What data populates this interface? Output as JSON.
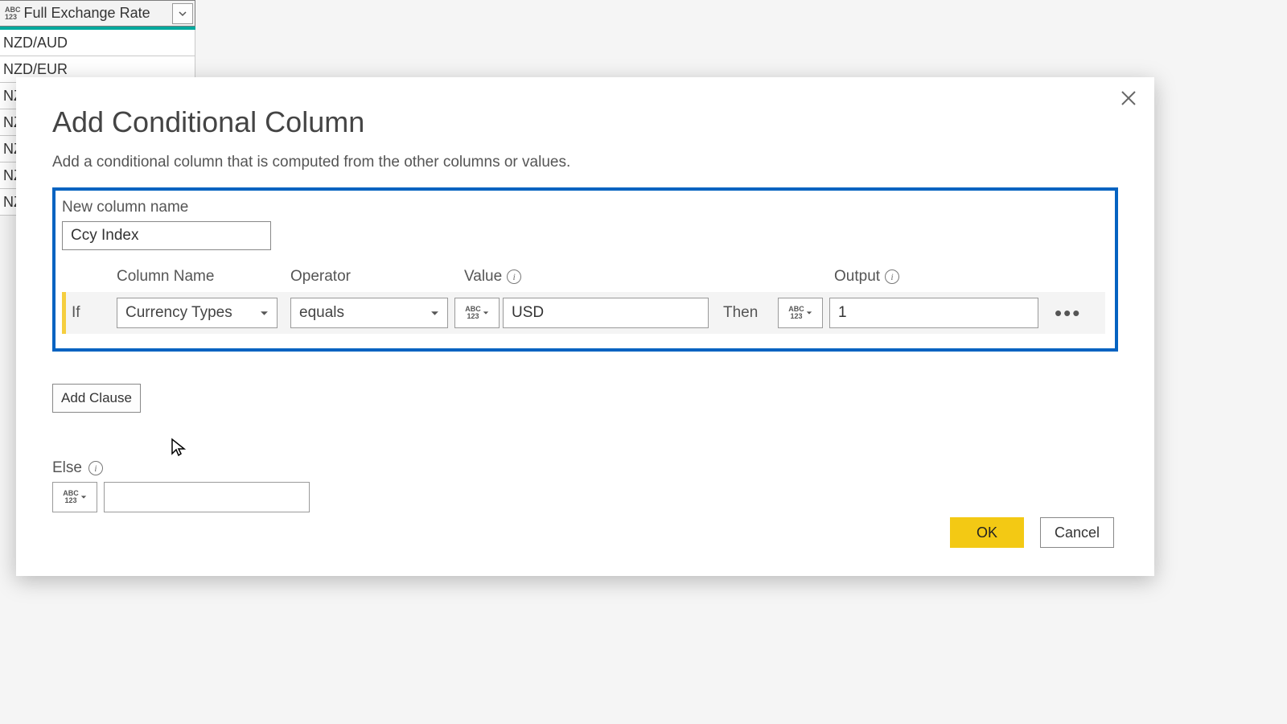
{
  "background_table": {
    "column_header": "Full Exchange Rate",
    "type_icon": "ABC\n123",
    "rows": [
      "NZD/AUD",
      "NZD/EUR",
      "NZ",
      "NZ",
      "NZ",
      "NZ",
      "NZ"
    ]
  },
  "dialog": {
    "title": "Add Conditional Column",
    "description": "Add a conditional column that is computed from the other columns or values.",
    "new_column_label": "New column name",
    "new_column_value": "Ccy Index",
    "headers": {
      "column_name": "Column Name",
      "operator": "Operator",
      "value": "Value",
      "output": "Output"
    },
    "row": {
      "if_label": "If",
      "column_name": "Currency Types",
      "operator": "equals",
      "value_type_icon": "ABC\n123",
      "value": "USD",
      "then_label": "Then",
      "output_type_icon": "ABC\n123",
      "output": "1"
    },
    "add_clause": "Add Clause",
    "else_label": "Else",
    "else_type_icon": "ABC\n123",
    "else_value": "",
    "ok": "OK",
    "cancel": "Cancel"
  }
}
